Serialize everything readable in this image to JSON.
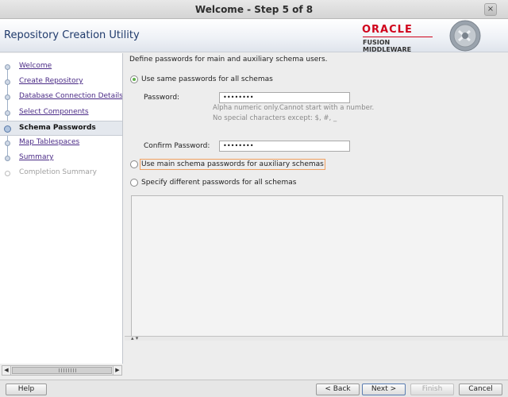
{
  "window": {
    "title": "Welcome - Step 5 of 8",
    "close_glyph": "×"
  },
  "header": {
    "app_title": "Repository Creation Utility",
    "brand_name": "ORACLE",
    "brand_sub": "FUSION MIDDLEWARE"
  },
  "sidebar": {
    "items": [
      {
        "label": "Welcome",
        "state": "done"
      },
      {
        "label": "Create Repository",
        "state": "done"
      },
      {
        "label": "Database Connection Details",
        "state": "done"
      },
      {
        "label": "Select Components",
        "state": "done"
      },
      {
        "label": "Schema Passwords",
        "state": "current"
      },
      {
        "label": "Map Tablespaces",
        "state": "todo"
      },
      {
        "label": "Summary",
        "state": "todo"
      },
      {
        "label": "Completion Summary",
        "state": "disabled"
      }
    ]
  },
  "main": {
    "description": "Define passwords for main and auxiliary schema users.",
    "options": [
      {
        "label": "Use same passwords for all schemas",
        "selected": true
      },
      {
        "label": "Use main schema passwords for auxiliary schemas",
        "selected": false
      },
      {
        "label": "Specify different passwords for all schemas",
        "selected": false
      }
    ],
    "password_label": "Password:",
    "password_value": "••••••••",
    "hint_line1": "Alpha numeric only.Cannot start with a number.",
    "hint_line2": "No special characters except: $, #, _",
    "confirm_label": "Confirm Password:",
    "confirm_value": "••••••••"
  },
  "footer": {
    "help": "Help",
    "back": "< Back",
    "next": "Next >",
    "finish": "Finish",
    "cancel": "Cancel"
  },
  "icons": {
    "scroll_left": "◀",
    "scroll_right": "▶",
    "splitter": "▴ ▾"
  },
  "colors": {
    "brand_red": "#d0021b",
    "link_purple": "#4a2a86",
    "radio_green": "#5fb14a"
  }
}
